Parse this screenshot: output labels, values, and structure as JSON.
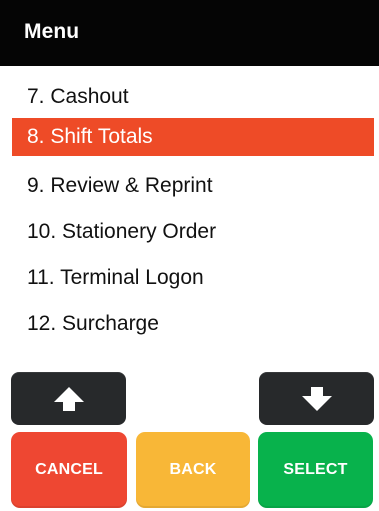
{
  "header": {
    "title": "Menu"
  },
  "menu": {
    "items": [
      {
        "label": "7. Cashout",
        "selected": false
      },
      {
        "label": "8. Shift Totals",
        "selected": true
      },
      {
        "label": "9. Review & Reprint",
        "selected": false
      },
      {
        "label": "10. Stationery Order",
        "selected": false
      },
      {
        "label": "11. Terminal Logon",
        "selected": false
      },
      {
        "label": "12. Surcharge",
        "selected": false
      }
    ]
  },
  "controls": {
    "up_icon": "arrow-up-icon",
    "down_icon": "arrow-down-icon",
    "cancel_label": "CANCEL",
    "back_label": "BACK",
    "select_label": "SELECT"
  },
  "colors": {
    "header": "#050505",
    "selected_item": "#ee4b27",
    "nav_button": "#27292b",
    "cancel_button": "#ee4732",
    "back_button": "#f8b737",
    "select_button": "#08b24c"
  }
}
